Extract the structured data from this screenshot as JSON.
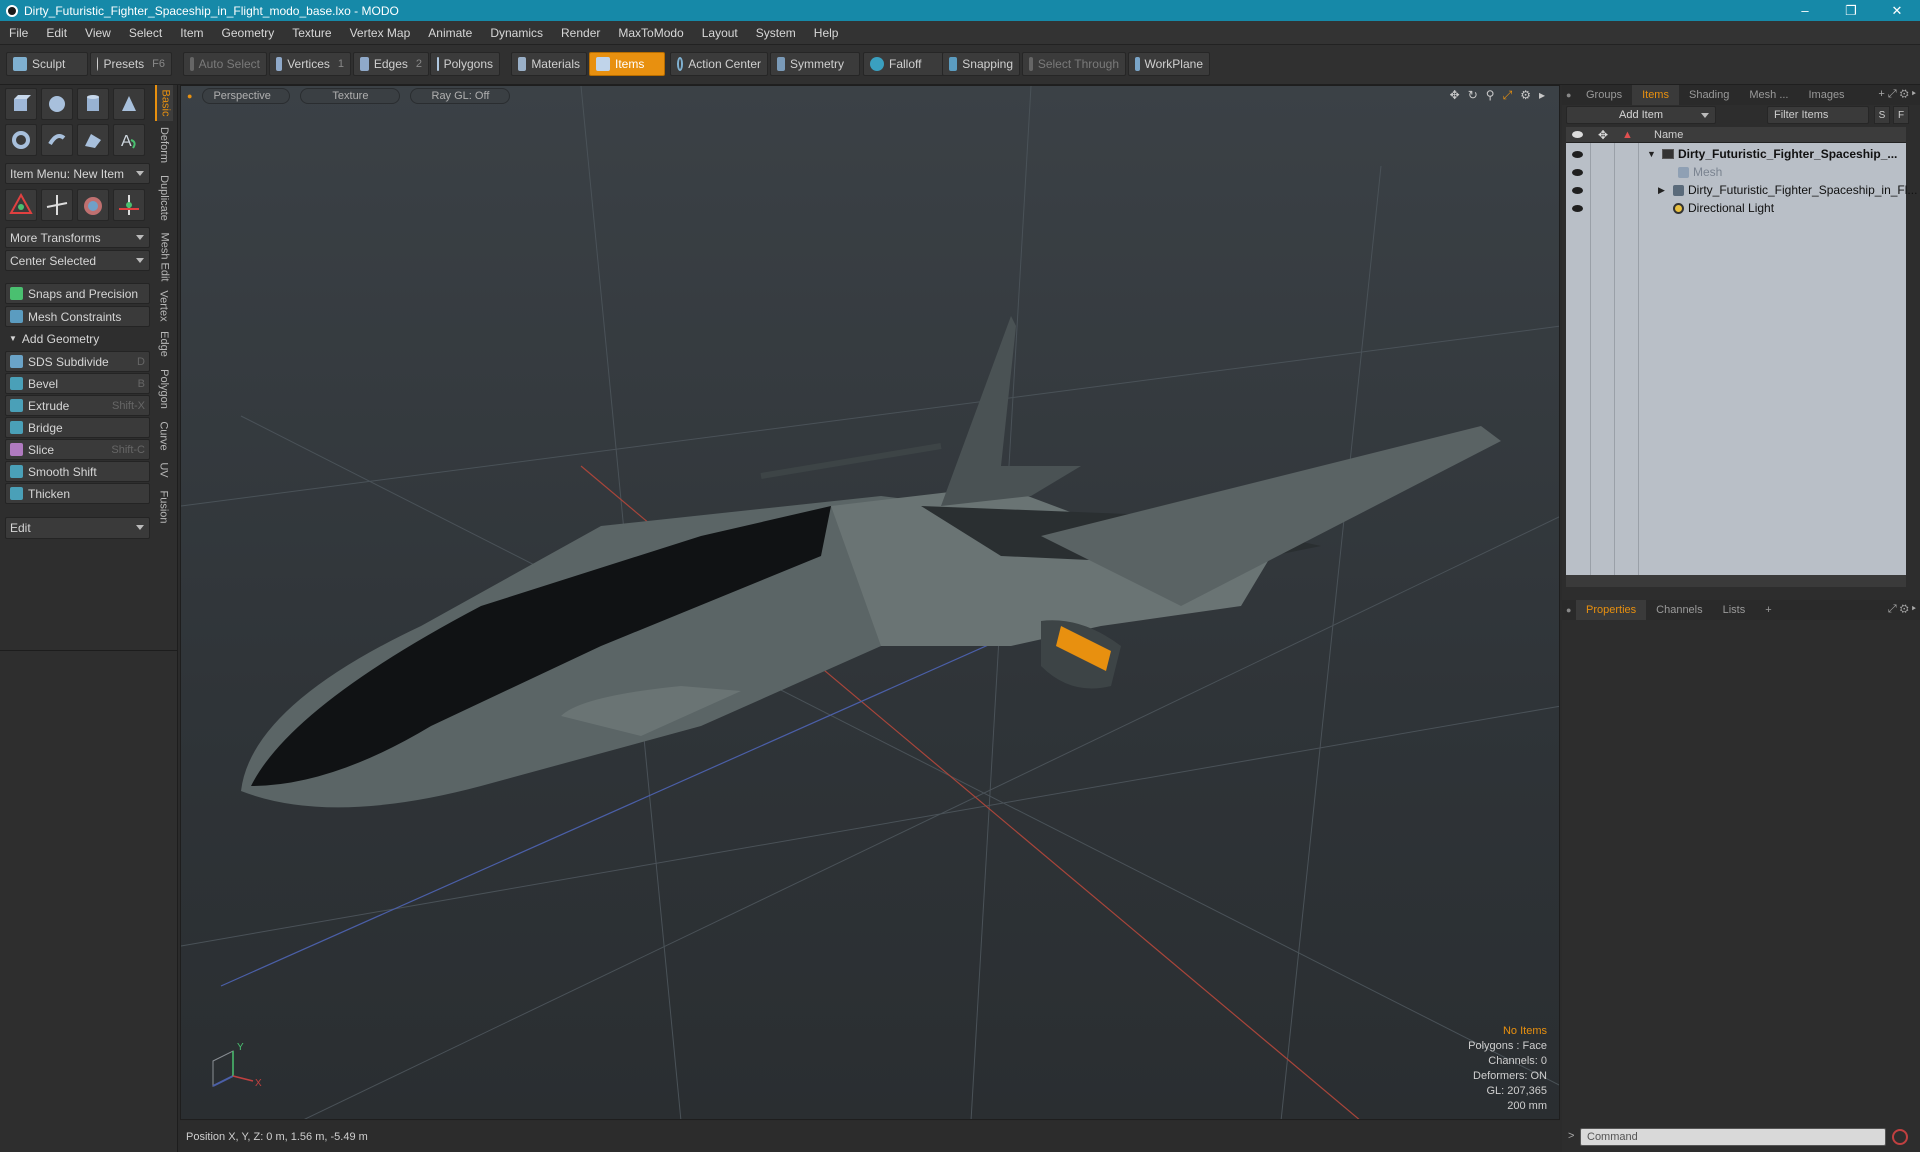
{
  "window": {
    "title": "Dirty_Futuristic_Fighter_Spaceship_in_Flight_modo_base.lxo - MODO",
    "controls": [
      "minimize-icon",
      "restore-icon",
      "close-icon"
    ]
  },
  "menu": [
    "File",
    "Edit",
    "View",
    "Select",
    "Item",
    "Geometry",
    "Texture",
    "Vertex Map",
    "Animate",
    "Dynamics",
    "Render",
    "MaxToModo",
    "Layout",
    "System",
    "Help"
  ],
  "toolbar": {
    "sculpt": "Sculpt",
    "presets": "Presets",
    "presets_key": "F6",
    "auto_select": "Auto Select",
    "vertices": "Vertices",
    "vertices_key": "1",
    "edges": "Edges",
    "edges_key": "2",
    "polygons": "Polygons",
    "materials": "Materials",
    "items": "Items",
    "action_center": "Action Center",
    "symmetry": "Symmetry",
    "falloff": "Falloff",
    "snapping": "Snapping",
    "select_through": "Select Through",
    "workplane": "WorkPlane"
  },
  "left": {
    "item_menu": "Item Menu: New Item",
    "more_transforms": "More Transforms",
    "center_selected": "Center Selected",
    "snaps": "Snaps and Precision",
    "mesh_constraints": "Mesh Constraints",
    "add_geometry": "Add Geometry",
    "tools": [
      {
        "label": "SDS Subdivide",
        "key": "D",
        "color": "#6aa3c7"
      },
      {
        "label": "Bevel",
        "key": "B",
        "color": "#4aa0b8"
      },
      {
        "label": "Extrude",
        "key": "Shift-X",
        "color": "#4aa0b8"
      },
      {
        "label": "Bridge",
        "key": "",
        "color": "#4aa0b8"
      },
      {
        "label": "Slice",
        "key": "Shift-C",
        "color": "#b07ac0"
      },
      {
        "label": "Smooth Shift",
        "key": "",
        "color": "#4aa0b8"
      },
      {
        "label": "Thicken",
        "key": "",
        "color": "#4aa0b8"
      }
    ],
    "edit": "Edit",
    "vtabs": [
      "Basic",
      "Deform",
      "Duplicate",
      "Mesh Edit",
      "Vertex",
      "Edge",
      "Polygon",
      "Curve",
      "UV",
      "Fusion"
    ]
  },
  "viewport": {
    "tabs": [
      "Perspective",
      "Texture",
      "Ray GL: Off"
    ],
    "stats": [
      "No Items",
      "Polygons : Face",
      "Channels: 0",
      "Deformers: ON",
      "GL: 207,365",
      "200 mm"
    ],
    "axis_y": "Y",
    "axis_x": "X"
  },
  "status": {
    "position": "Position X, Y, Z:   0 m, 1.56 m, -5.49 m"
  },
  "right": {
    "tabs": [
      "Groups",
      "Items",
      "Shading",
      "Mesh ...",
      "Images"
    ],
    "add_item": "Add Item",
    "filter_items": "Filter Items",
    "filter_s": "S",
    "filter_f": "F",
    "col_name": "Name",
    "items": [
      {
        "label": "Dirty_Futuristic_Fighter_Spaceship_...",
        "style": "bold"
      },
      {
        "label": "Mesh",
        "style": "dim"
      },
      {
        "label": "Dirty_Futuristic_Fighter_Spaceship_in_Fl...",
        "style": "normal"
      },
      {
        "label": "Directional Light",
        "style": "normal"
      }
    ],
    "bottom_tabs": [
      "Properties",
      "Channels",
      "Lists"
    ],
    "command_placeholder": "Command"
  }
}
